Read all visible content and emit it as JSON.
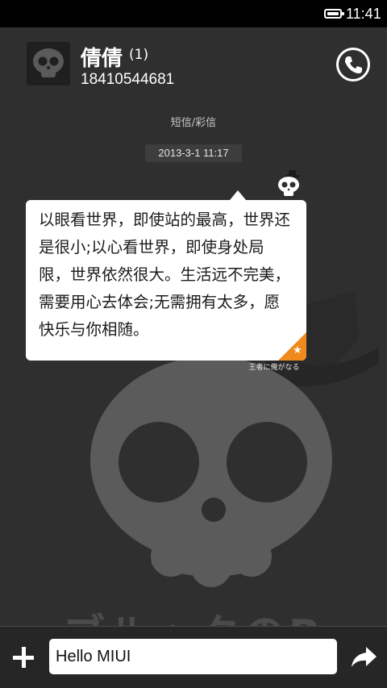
{
  "status_bar": {
    "time": "11:41",
    "battery_icon": "battery-icon"
  },
  "header": {
    "contact_name": "倩倩",
    "unread_count": "(1)",
    "phone_number": "18410544681",
    "call_icon": "phone-icon"
  },
  "conversation": {
    "channel_label": "短信/彩信",
    "timestamp": "2013-3-1 11:17",
    "messages": [
      {
        "text": "以眼看世界，即使站的最高，世界还是很小;以心看世界，即使身处局限，世界依然很大。生活远不完美，需要用心去体会;无需拥有太多，愿快乐与你相随。",
        "badge_icon": "star-icon",
        "signature": "王者に俺がなる"
      }
    ]
  },
  "wallpaper": {
    "text": "ブルックのBrook"
  },
  "composer": {
    "input_value": "Hello MIUI",
    "add_icon": "plus-icon",
    "send_icon": "send-arrow-icon"
  },
  "colors": {
    "background": "#2f2f2f",
    "accent": "#f08a1c",
    "bubble": "#ffffff"
  }
}
